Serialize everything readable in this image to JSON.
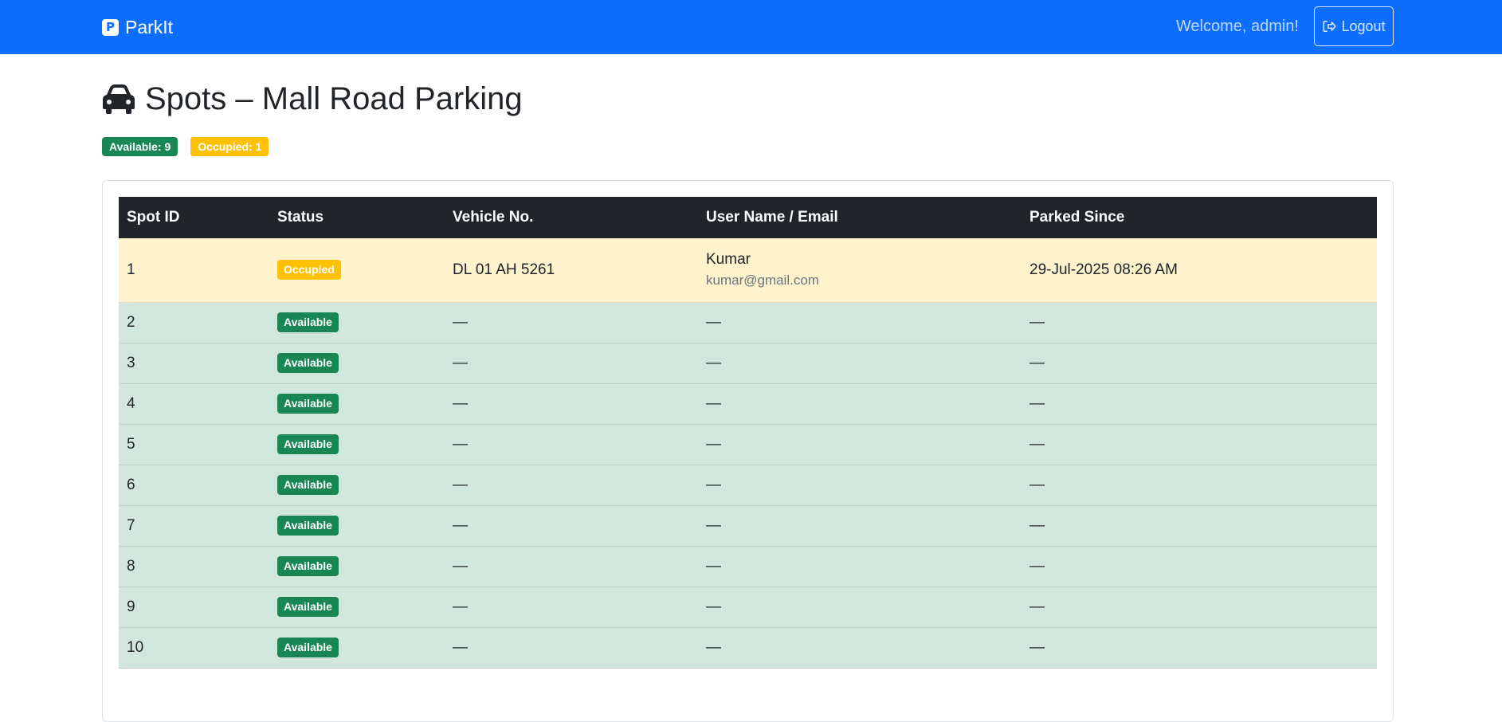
{
  "navbar": {
    "brand": "ParkIt",
    "welcome": "Welcome, admin!",
    "logout_label": "Logout",
    "color": "#0d6efd"
  },
  "page": {
    "title": "Spots – Mall Road Parking",
    "icon": "car-icon"
  },
  "summary": {
    "available": "Available: 9",
    "occupied": "Occupied: 1"
  },
  "table": {
    "headers": [
      "Spot ID",
      "Status",
      "Vehicle No.",
      "User Name / Email",
      "Parked Since"
    ],
    "rows": [
      {
        "spot": "1",
        "status": "Occupied",
        "vehicle": "DL 01 AH 5261",
        "user_name": "Kumar",
        "user_email": "kumar@gmail.com",
        "since": "29-Jul-2025 08:26 AM"
      },
      {
        "spot": "2",
        "status": "Available",
        "vehicle": "—",
        "user": "—",
        "since": "—"
      },
      {
        "spot": "3",
        "status": "Available",
        "vehicle": "—",
        "user": "—",
        "since": "—"
      },
      {
        "spot": "4",
        "status": "Available",
        "vehicle": "—",
        "user": "—",
        "since": "—"
      },
      {
        "spot": "5",
        "status": "Available",
        "vehicle": "—",
        "user": "—",
        "since": "—"
      },
      {
        "spot": "6",
        "status": "Available",
        "vehicle": "—",
        "user": "—",
        "since": "—"
      },
      {
        "spot": "7",
        "status": "Available",
        "vehicle": "—",
        "user": "—",
        "since": "—"
      },
      {
        "spot": "8",
        "status": "Available",
        "vehicle": "—",
        "user": "—",
        "since": "—"
      },
      {
        "spot": "9",
        "status": "Available",
        "vehicle": "—",
        "user": "—",
        "since": "—"
      },
      {
        "spot": "10",
        "status": "Available",
        "vehicle": "—",
        "user": "—",
        "since": "—"
      }
    ]
  },
  "colors": {
    "available": "#198754",
    "occupied": "#ffc107",
    "available_row": "#d1e7dd",
    "occupied_row": "#fff3cd",
    "header": "#212529"
  }
}
